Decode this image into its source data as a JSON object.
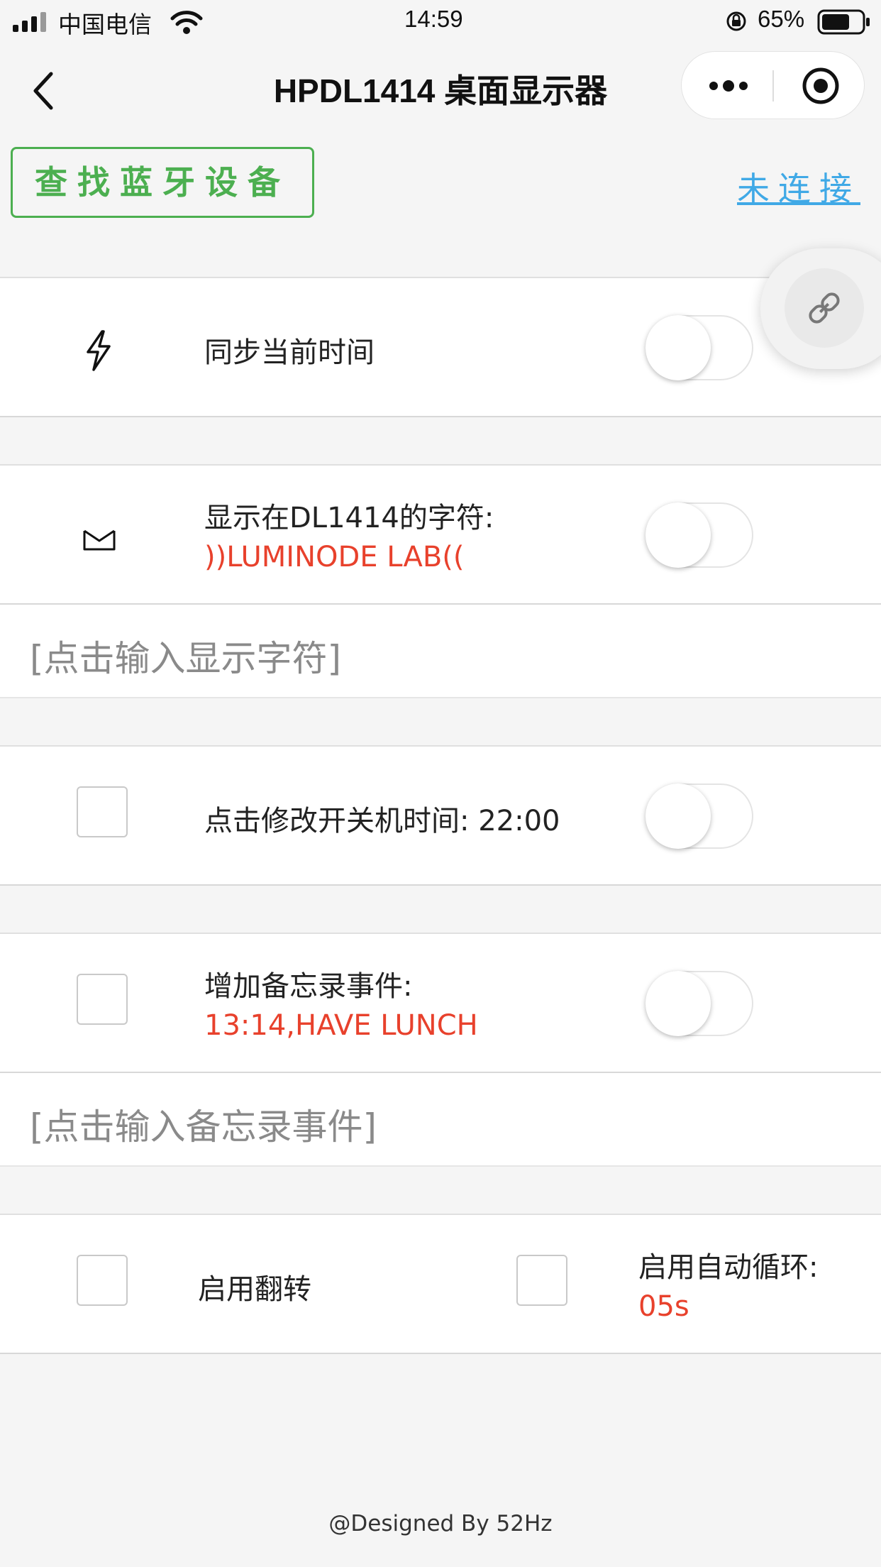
{
  "status_bar": {
    "carrier": "中国电信",
    "time": "14:59",
    "battery": "65%"
  },
  "nav": {
    "title": "HPDL1414 桌面显示器"
  },
  "actions": {
    "find_button": "查找蓝牙设备",
    "connection_status": "未连接"
  },
  "sync_row": {
    "label": "同步当前时间",
    "icon": "lightning-icon",
    "toggle_on": false
  },
  "display_row": {
    "label": "显示在DL1414的字符:",
    "value": "))LUMINODE LAB((",
    "icon": "mail-icon",
    "toggle_on": false,
    "input_placeholder": "[点击输入显示字符]"
  },
  "power_row": {
    "label": "点击修改开关机时间: 22:00",
    "toggle_on": false
  },
  "memo_row": {
    "label": "增加备忘录事件:",
    "value": "13:14,HAVE LUNCH",
    "toggle_on": false,
    "input_placeholder": "[点击输入备忘录事件]"
  },
  "options_row": {
    "flip_label": "启用翻转",
    "cycle_label": "启用自动循环:",
    "cycle_value": "05s"
  },
  "footer": "@Designed By 52Hz",
  "colors": {
    "accent_green": "#4caf50",
    "link_blue": "#40a9e6",
    "value_red": "#e8412c"
  }
}
